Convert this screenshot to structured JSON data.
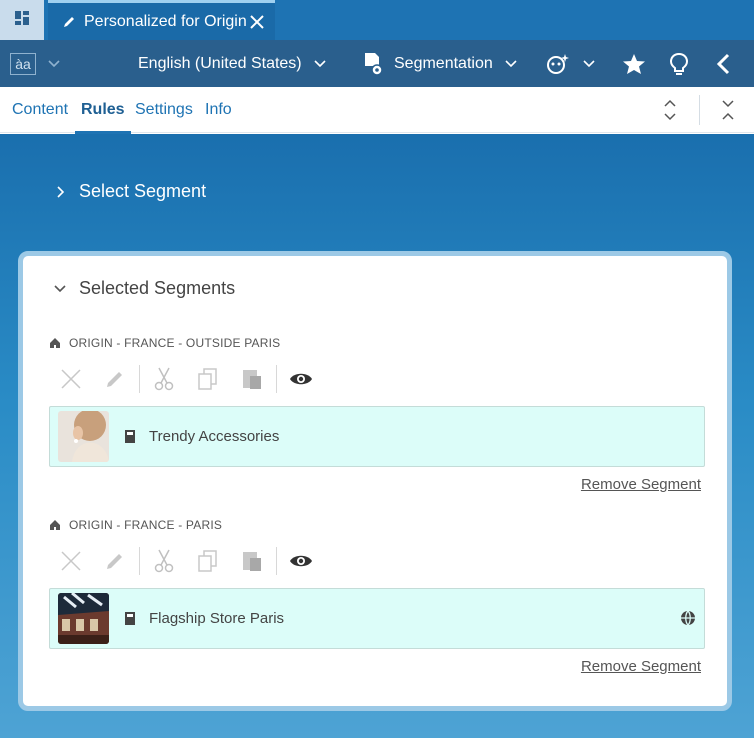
{
  "tab": {
    "title": "Personalized for Origin"
  },
  "toolbar": {
    "language_value": "English (United States)",
    "segmentation_label": "Segmentation"
  },
  "nav": {
    "tabs": [
      {
        "label": "Content",
        "active": false
      },
      {
        "label": "Rules",
        "active": true
      },
      {
        "label": "Settings",
        "active": false
      },
      {
        "label": "Info",
        "active": false
      }
    ]
  },
  "main": {
    "select_segment_label": "Select Segment",
    "selected_segments_title": "Selected Segments",
    "segments": [
      {
        "label": "ORIGIN - FRANCE - OUTSIDE PARIS",
        "item_name": "Trendy Accessories",
        "remove_label": "Remove Segment"
      },
      {
        "label": "ORIGIN - FRANCE - PARIS",
        "item_name": "Flagship Store Paris",
        "remove_label": "Remove Segment"
      }
    ]
  },
  "icons": {
    "dashboard": "dashboard-icon",
    "pencil": "pencil-icon",
    "close": "close-icon",
    "language": "language-icon",
    "segmentation": "segmentation-icon",
    "personalization": "personalization-icon",
    "star": "star-icon",
    "lightbulb": "lightbulb-icon",
    "back": "chevron-left-icon",
    "expand_all": "expand-all-icon",
    "collapse_all": "collapse-all-icon",
    "home": "home-icon",
    "delete": "delete-icon",
    "edit": "edit-icon",
    "cut": "cut-icon",
    "copy": "copy-icon",
    "paste": "paste-icon",
    "preview": "eye-icon",
    "content_type": "content-type-icon",
    "globe": "globe-icon"
  },
  "colors": {
    "tabstrip": "#1e73b3",
    "toolbar": "#2a5f8d",
    "accent": "#1e73b3",
    "card_background": "#dcfdf9",
    "panel_border": "#9cc9e6"
  }
}
